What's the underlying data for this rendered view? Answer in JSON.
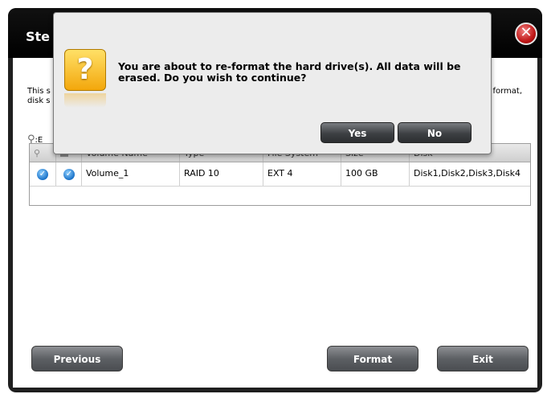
{
  "window": {
    "title": "Ste",
    "close_icon": "close-x-icon"
  },
  "description": {
    "left_line1": "This s",
    "left_line2": "disk s",
    "right_line1": "format,"
  },
  "edit_label": ":E",
  "table": {
    "columns": [
      "",
      "",
      "Volume Name",
      "Type",
      "File System",
      "Size",
      "Disk"
    ],
    "rows": [
      {
        "volume_name": "Volume_1",
        "type": "RAID 10",
        "file_system": "EXT 4",
        "size": "100 GB",
        "disk": "Disk1,Disk2,Disk3,Disk4"
      }
    ]
  },
  "buttons": {
    "previous": "Previous",
    "format": "Format",
    "exit": "Exit"
  },
  "dialog": {
    "icon": "question-icon",
    "message": "You are about to re-format the hard drive(s). All data will be erased. Do you wish to continue?",
    "yes": "Yes",
    "no": "No"
  },
  "colors": {
    "window_bg": "#1f1f1f",
    "close_red": "#c01818",
    "check_blue": "#1a72c8",
    "question_yellow": "#f3a70c"
  }
}
